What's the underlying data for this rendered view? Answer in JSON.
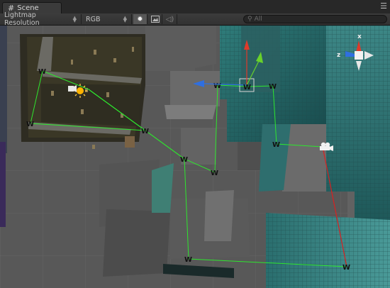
{
  "tab": {
    "title": "Scene",
    "icon": "grid-icon"
  },
  "toolbar": {
    "render_mode": "Lightmap Resolution",
    "color_mode": "RGB",
    "lighting_toggle": "sun-icon",
    "image_toggle": "image-icon",
    "audio_toggle": "speaker-icon",
    "search_placeholder": "All"
  },
  "waypoints": {
    "label": "W",
    "path_color": "#2ee62e",
    "camera_link_color": "#e02020"
  },
  "colors": {
    "gizmo_x": "#e03a2a",
    "gizmo_y": "#69d22a",
    "gizmo_z": "#2f6fe0",
    "background": "#585858"
  }
}
